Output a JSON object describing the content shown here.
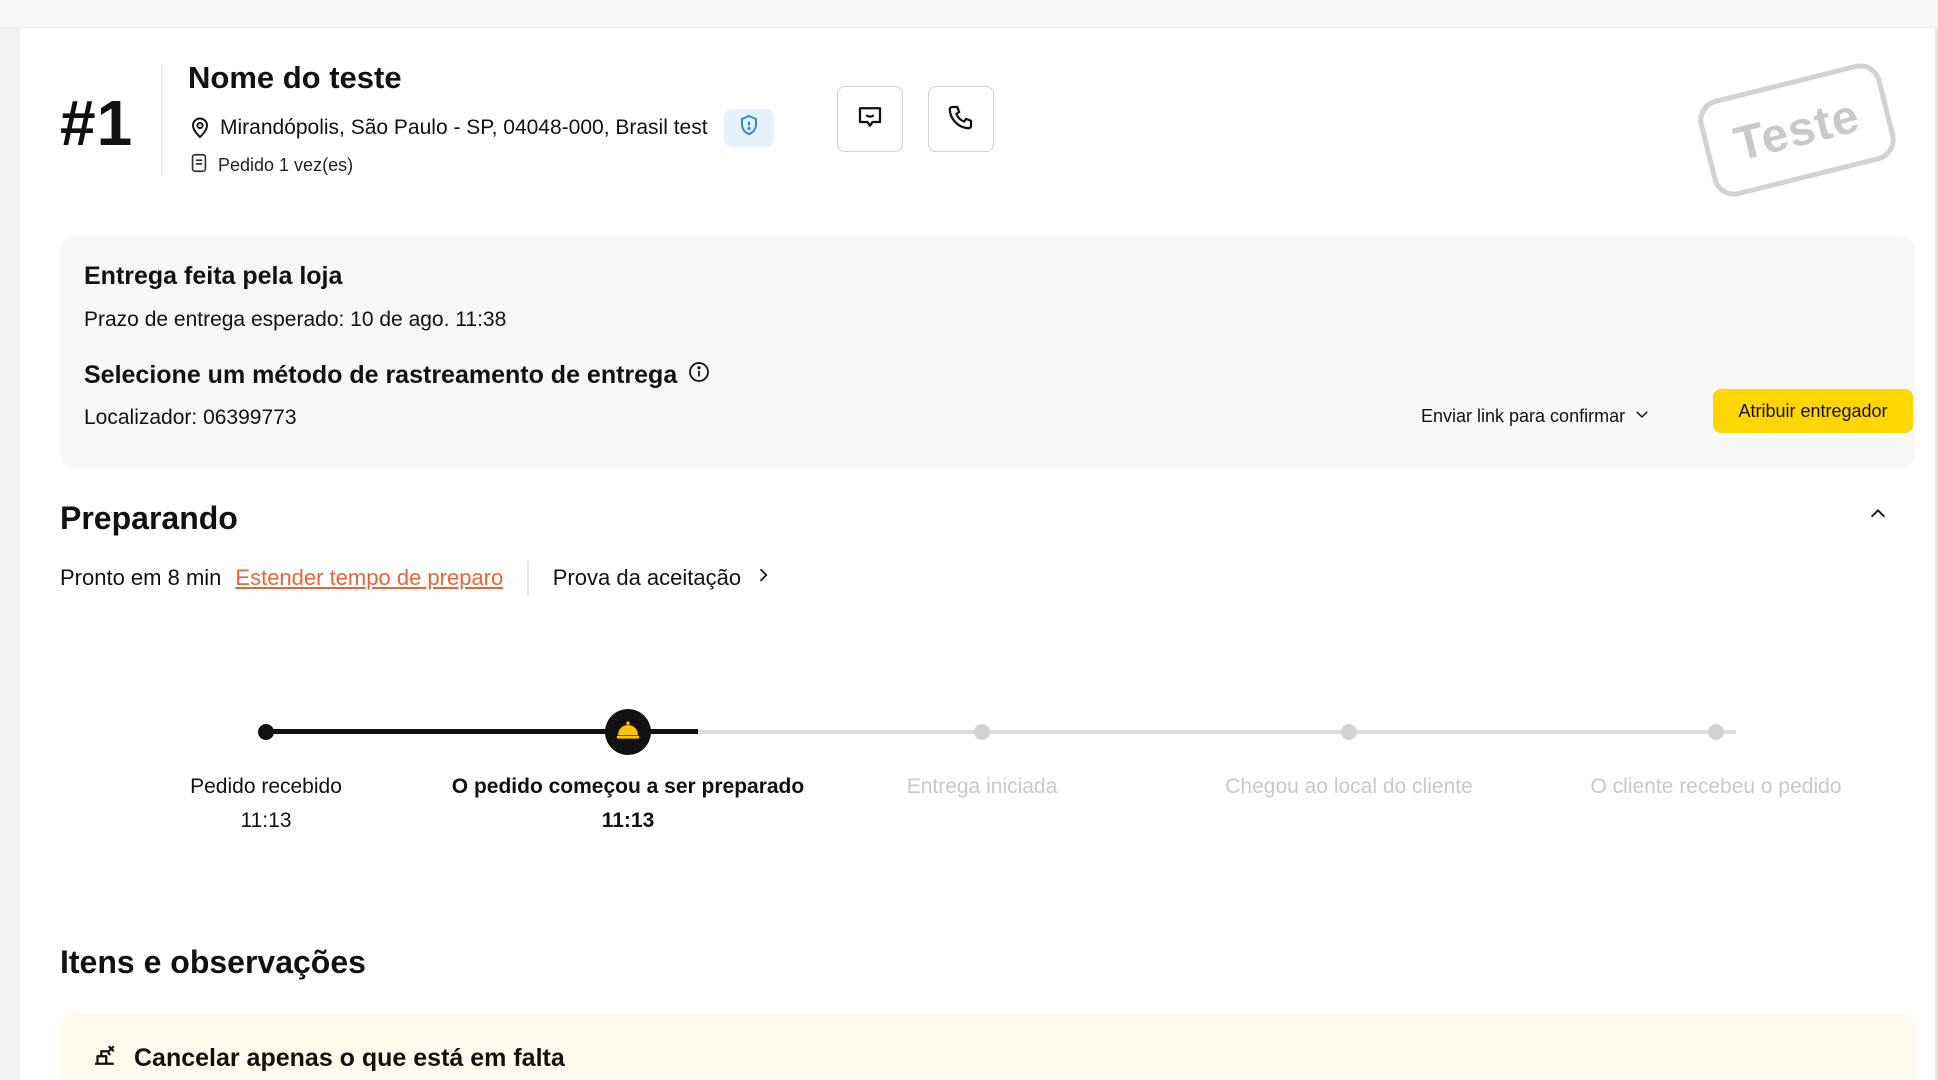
{
  "order": {
    "number": "#1",
    "customer_name": "Nome do teste",
    "address": "Mirandópolis, São Paulo - SP, 04048-000, Brasil test",
    "order_count": "Pedido 1 vez(es)",
    "stamp": "Teste"
  },
  "delivery": {
    "title": "Entrega feita pela loja",
    "deadline": "Prazo de entrega esperado: 10 de ago. 11:38",
    "tracking_title": "Selecione um método de rastreamento de entrega",
    "locator": "Localizador: 06399773",
    "send_link_label": "Enviar link para confirmar",
    "assign_button": "Atribuir entregador"
  },
  "preparing": {
    "title": "Preparando",
    "ready_in": "Pronto em 8 min",
    "extend_link": "Estender tempo de preparo",
    "proof_link": "Prova da aceitação"
  },
  "timeline": {
    "progress_fraction": 0.3,
    "steps": [
      {
        "label": "Pedido recebido",
        "time": "11:13",
        "state": "done"
      },
      {
        "label": "O pedido começou a ser preparado",
        "time": "11:13",
        "state": "current"
      },
      {
        "label": "Entrega iniciada",
        "time": "",
        "state": "todo"
      },
      {
        "label": "Chegou ao local do cliente",
        "time": "",
        "state": "todo"
      },
      {
        "label": "O cliente recebeu o pedido",
        "time": "",
        "state": "todo"
      }
    ]
  },
  "items": {
    "title": "Itens e observações",
    "notice": "Cancelar apenas o que está em falta"
  },
  "colors": {
    "accent_yellow": "#ffd600",
    "link_orange": "#e8653a",
    "shield_bg": "#e5f1fb",
    "notice_bg": "#fffaed"
  },
  "icons": [
    "location-pin-icon",
    "shield-icon",
    "receipt-icon",
    "chat-icon",
    "phone-icon",
    "info-icon",
    "chevron-down-icon",
    "chevron-up-icon",
    "chevron-right-icon",
    "service-bell-icon",
    "cancel-item-icon"
  ]
}
